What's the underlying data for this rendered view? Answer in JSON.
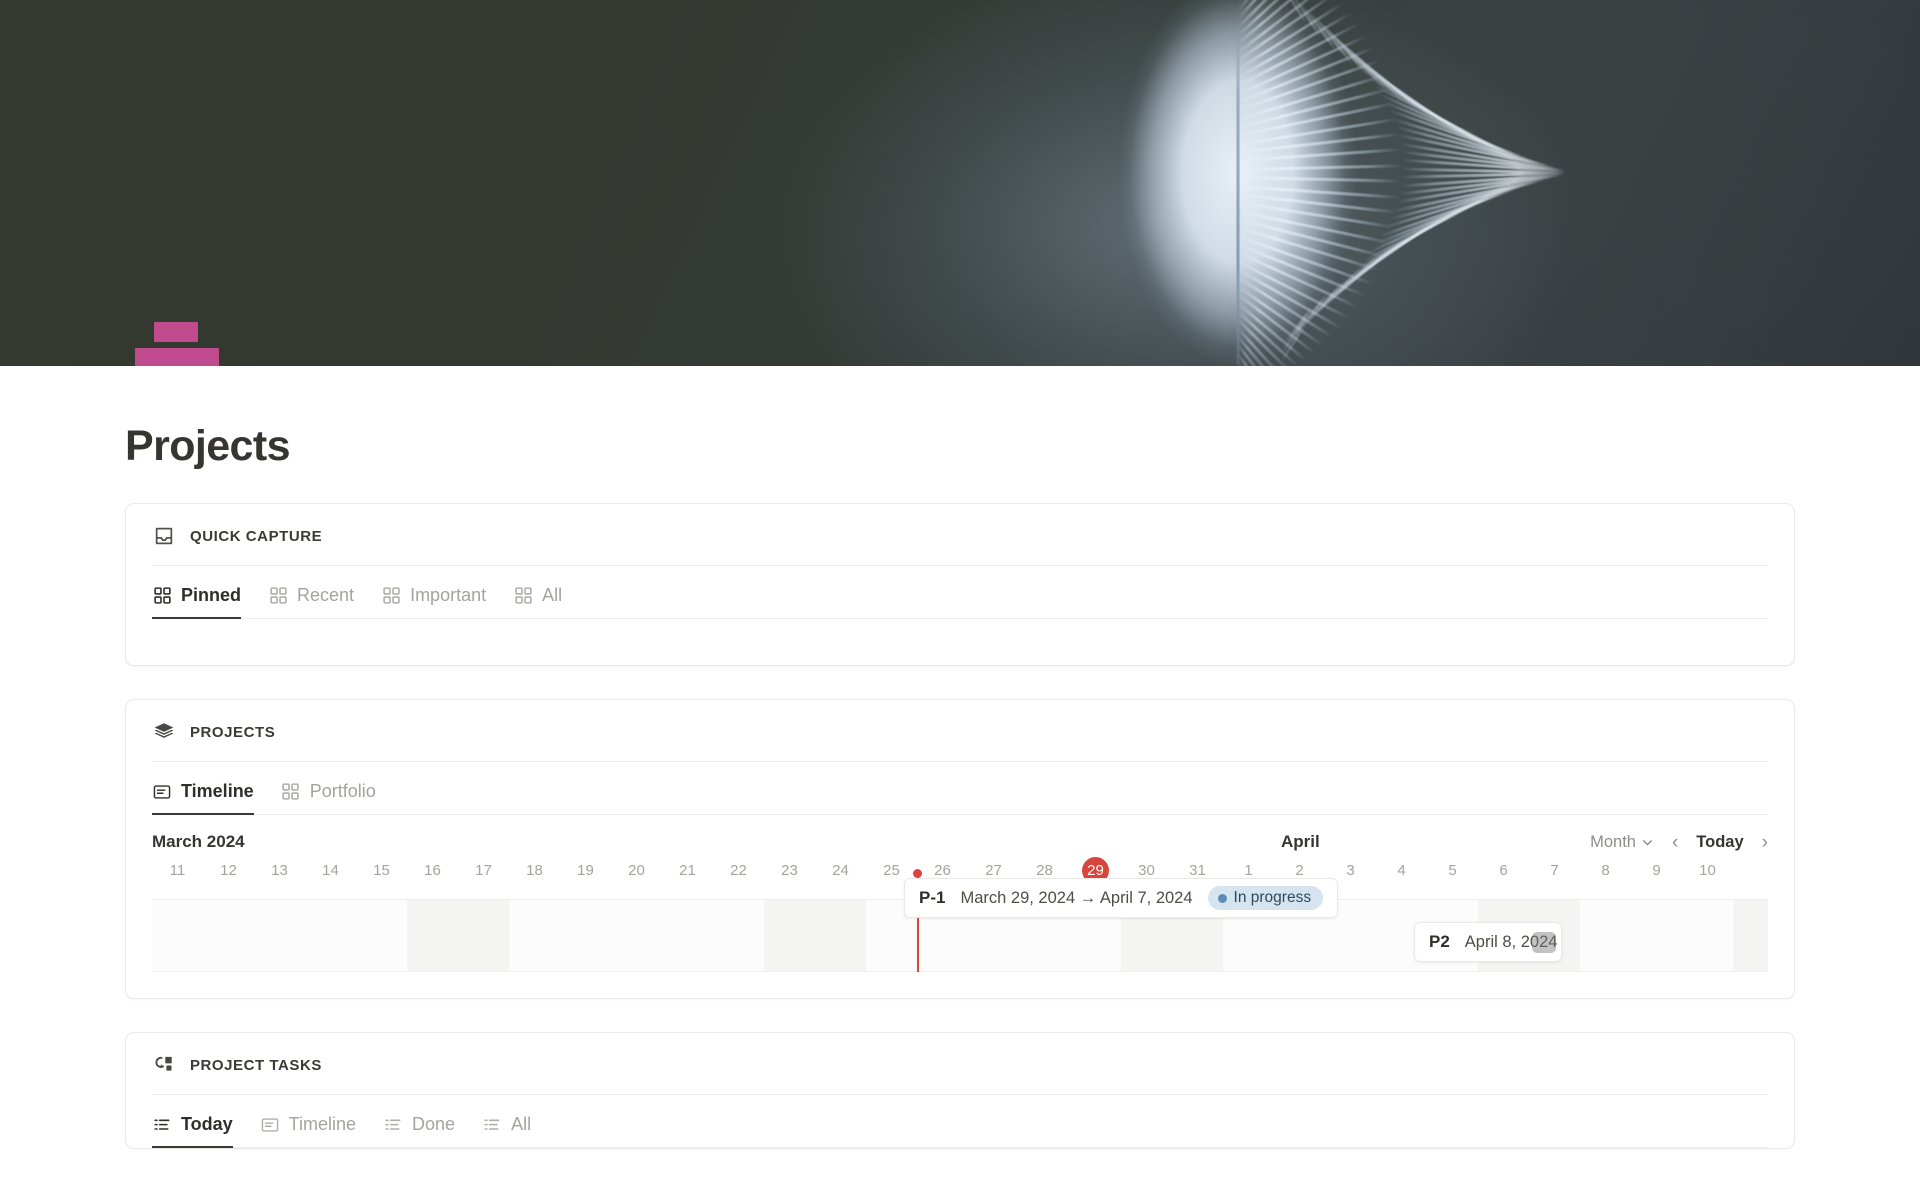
{
  "banner": {
    "image_description": "white feather on dark olive background",
    "background_color": "#33382f"
  },
  "page": {
    "icon_name": "magenta-bars-icon",
    "icon_color": "#c04a8e",
    "title": "Projects"
  },
  "quick_capture": {
    "icon": "inbox-icon",
    "title": "QUICK CAPTURE",
    "tabs": [
      {
        "label": "Pinned",
        "icon": "grid-icon",
        "active": true
      },
      {
        "label": "Recent",
        "icon": "grid-icon",
        "active": false
      },
      {
        "label": "Important",
        "icon": "grid-icon",
        "active": false
      },
      {
        "label": "All",
        "icon": "grid-icon",
        "active": false
      }
    ]
  },
  "projects": {
    "icon": "layers-icon",
    "title": "PROJECTS",
    "tabs": [
      {
        "label": "Timeline",
        "icon": "panel-list-icon",
        "active": true
      },
      {
        "label": "Portfolio",
        "icon": "grid-icon",
        "active": false
      }
    ],
    "timeline": {
      "month_left": "March 2024",
      "month_right": "April",
      "zoom_label": "Month",
      "zoom_caret": "⌄",
      "prev_label": "‹",
      "today_label": "Today",
      "next_label": "›",
      "today_marker": "29",
      "today_color": "#d9453c",
      "days": [
        {
          "n": "11",
          "weekend": false
        },
        {
          "n": "12",
          "weekend": false
        },
        {
          "n": "13",
          "weekend": false
        },
        {
          "n": "14",
          "weekend": false
        },
        {
          "n": "15",
          "weekend": false
        },
        {
          "n": "16",
          "weekend": true
        },
        {
          "n": "17",
          "weekend": true
        },
        {
          "n": "18",
          "weekend": false
        },
        {
          "n": "19",
          "weekend": false
        },
        {
          "n": "20",
          "weekend": false
        },
        {
          "n": "21",
          "weekend": false
        },
        {
          "n": "22",
          "weekend": false
        },
        {
          "n": "23",
          "weekend": true
        },
        {
          "n": "24",
          "weekend": true
        },
        {
          "n": "25",
          "weekend": false
        },
        {
          "n": "26",
          "weekend": false
        },
        {
          "n": "27",
          "weekend": false
        },
        {
          "n": "28",
          "weekend": false
        },
        {
          "n": "29",
          "weekend": false,
          "today": true
        },
        {
          "n": "30",
          "weekend": true
        },
        {
          "n": "31",
          "weekend": true
        },
        {
          "n": "1",
          "weekend": false
        },
        {
          "n": "2",
          "weekend": false
        },
        {
          "n": "3",
          "weekend": false
        },
        {
          "n": "4",
          "weekend": false
        },
        {
          "n": "5",
          "weekend": false
        },
        {
          "n": "6",
          "weekend": true
        },
        {
          "n": "7",
          "weekend": true
        },
        {
          "n": "8",
          "weekend": false
        },
        {
          "n": "9",
          "weekend": false
        },
        {
          "n": "10",
          "weekend": false
        }
      ],
      "items": [
        {
          "id": "P-1",
          "range": "March 29, 2024 → April 7, 2024",
          "status": "In progress",
          "status_bg": "#d6e4f0",
          "status_dot": "#5b8db8"
        },
        {
          "id": "P2",
          "range": "April 8, 2024 ·",
          "status": "",
          "status_bg": "",
          "status_dot": ""
        }
      ]
    }
  },
  "project_tasks": {
    "icon": "workflow-icon",
    "title": "PROJECT TASKS",
    "tabs": [
      {
        "label": "Today",
        "icon": "list-icon",
        "active": true
      },
      {
        "label": "Timeline",
        "icon": "panel-list-icon",
        "active": false
      },
      {
        "label": "Done",
        "icon": "list-icon",
        "active": false
      },
      {
        "label": "All",
        "icon": "list-icon",
        "active": false
      }
    ]
  }
}
